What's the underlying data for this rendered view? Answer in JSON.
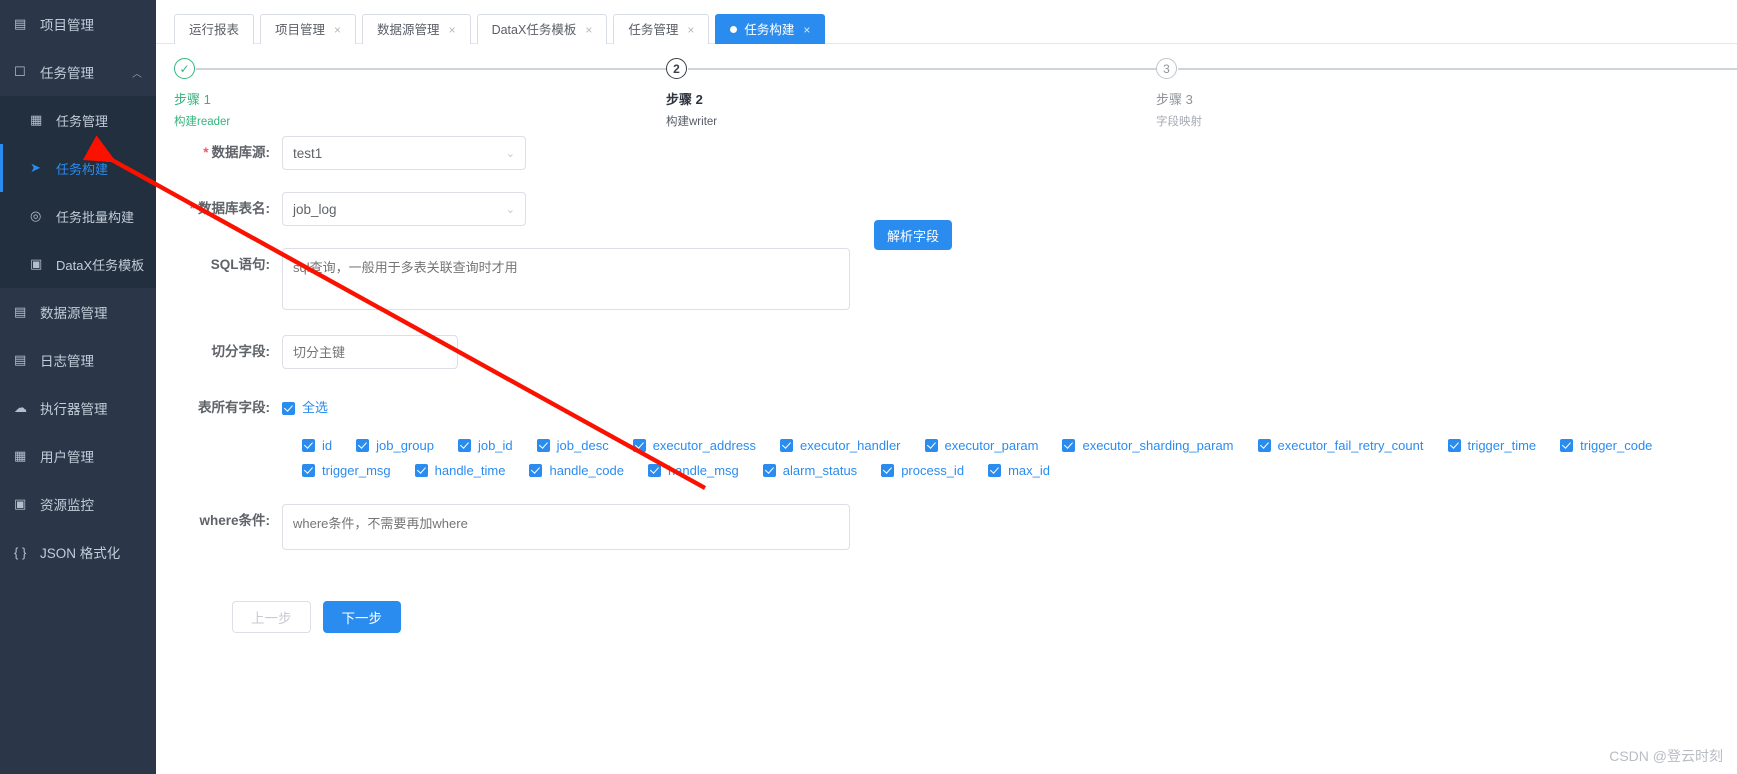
{
  "sidebar": {
    "items": [
      {
        "label": "项目管理",
        "icon": "project-icon",
        "level": 0,
        "active": false,
        "caret": ""
      },
      {
        "label": "任务管理",
        "icon": "monitor-icon",
        "level": 0,
        "active": false,
        "caret": "︿"
      },
      {
        "label": "任务管理",
        "icon": "calendar-icon",
        "level": 1,
        "active": false,
        "caret": ""
      },
      {
        "label": "任务构建",
        "icon": "send-icon",
        "level": 1,
        "active": true,
        "caret": ""
      },
      {
        "label": "任务批量构建",
        "icon": "compass-icon",
        "level": 1,
        "active": false,
        "caret": ""
      },
      {
        "label": "DataX任务模板",
        "icon": "clipboard-icon",
        "level": 1,
        "active": false,
        "caret": ""
      },
      {
        "label": "数据源管理",
        "icon": "database-icon",
        "level": 0,
        "active": false,
        "caret": ""
      },
      {
        "label": "日志管理",
        "icon": "document-icon",
        "level": 0,
        "active": false,
        "caret": ""
      },
      {
        "label": "执行器管理",
        "icon": "cloud-icon",
        "level": 0,
        "active": false,
        "caret": ""
      },
      {
        "label": "用户管理",
        "icon": "grid-icon",
        "level": 0,
        "active": false,
        "caret": ""
      },
      {
        "label": "资源监控",
        "icon": "monitor-chart-icon",
        "level": 0,
        "active": false,
        "caret": ""
      },
      {
        "label": "JSON 格式化",
        "icon": "braces-icon",
        "level": 0,
        "active": false,
        "caret": ""
      }
    ]
  },
  "tabs": [
    {
      "label": "运行报表",
      "closable": false,
      "active": false
    },
    {
      "label": "项目管理",
      "closable": true,
      "active": false
    },
    {
      "label": "数据源管理",
      "closable": true,
      "active": false
    },
    {
      "label": "DataX任务模板",
      "closable": true,
      "active": false
    },
    {
      "label": "任务管理",
      "closable": true,
      "active": false
    },
    {
      "label": "任务构建",
      "closable": true,
      "active": true
    }
  ],
  "steps": [
    {
      "num": "✓",
      "title": "步骤 1",
      "desc": "构建reader",
      "state": "done"
    },
    {
      "num": "2",
      "title": "步骤 2",
      "desc": "构建writer",
      "state": "current"
    },
    {
      "num": "3",
      "title": "步骤 3",
      "desc": "字段映射",
      "state": "todo"
    }
  ],
  "form": {
    "datasource": {
      "label": "数据库源:",
      "required": true,
      "value": "test1"
    },
    "table": {
      "label": "数据库表名:",
      "required": true,
      "value": "job_log"
    },
    "sql": {
      "label": "SQL语句:",
      "required": false,
      "value": "",
      "placeholder": "sql查询，一般用于多表关联查询时才用"
    },
    "parse_button": "解析字段",
    "split": {
      "label": "切分字段:",
      "required": false,
      "value": "",
      "placeholder": "切分主键"
    },
    "all_fields": {
      "label": "表所有字段:",
      "select_all": "全选",
      "checked": true
    },
    "where": {
      "label": "where条件:",
      "required": false,
      "value": "",
      "placeholder": "where条件，不需要再加where"
    }
  },
  "fields_row1": [
    "id",
    "job_group",
    "job_id",
    "job_desc",
    "executor_address",
    "executor_handler",
    "executor_param",
    "executor_sharding_param",
    "executor_fail_retry_count",
    "trigger_time",
    "trigger_code"
  ],
  "fields_row2": [
    "trigger_msg",
    "handle_time",
    "handle_code",
    "handle_msg",
    "alarm_status",
    "process_id",
    "max_id"
  ],
  "footer": {
    "prev": "上一步",
    "next": "下一步"
  },
  "watermark": "CSDN @登云时刻",
  "colors": {
    "accent": "#2b8cf0",
    "sidebar_bg": "#2b3748",
    "sidebar_sub_bg": "#222f3e",
    "done_green": "#36b37e",
    "required_red": "#f45b5b",
    "arrow_red": "#fb1100"
  }
}
